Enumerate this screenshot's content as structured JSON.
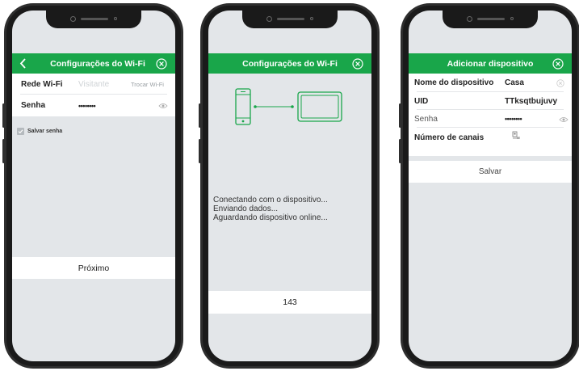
{
  "screen1": {
    "title": "Configurações do Wi-Fi",
    "wifi_label": "Rede Wi-Fi",
    "wifi_placeholder": "Visitante",
    "wifi_action": "Trocar Wi-Fi",
    "password_label": "Senha",
    "password_value": "••••••••",
    "save_password_label": "Salvar senha",
    "save_password_checked": true,
    "next_button": "Próximo"
  },
  "screen2": {
    "title": "Configurações do Wi-Fi",
    "status_lines": [
      "Conectando com o dispositivo...",
      "Enviando dados...",
      "Aguardando dispositivo online..."
    ],
    "countdown": "143"
  },
  "screen3": {
    "title": "Adicionar dispositivo",
    "device_name_label": "Nome do dispositivo",
    "device_name_value": "Casa",
    "uid_label": "UID",
    "uid_value": "TTksqtbujuvy",
    "password_label": "Senha",
    "password_value": "••••••••",
    "channels_label": "Número de canais",
    "save_button": "Salvar"
  },
  "colors": {
    "accent": "#19a64a",
    "screen_bg": "#e3e6e9",
    "frame": "#2e2e2e"
  },
  "icons": [
    "back-icon",
    "close-icon",
    "eye-icon",
    "checkbox-icon",
    "phone-icon",
    "monitor-icon",
    "clear-icon",
    "channels-icon"
  ]
}
